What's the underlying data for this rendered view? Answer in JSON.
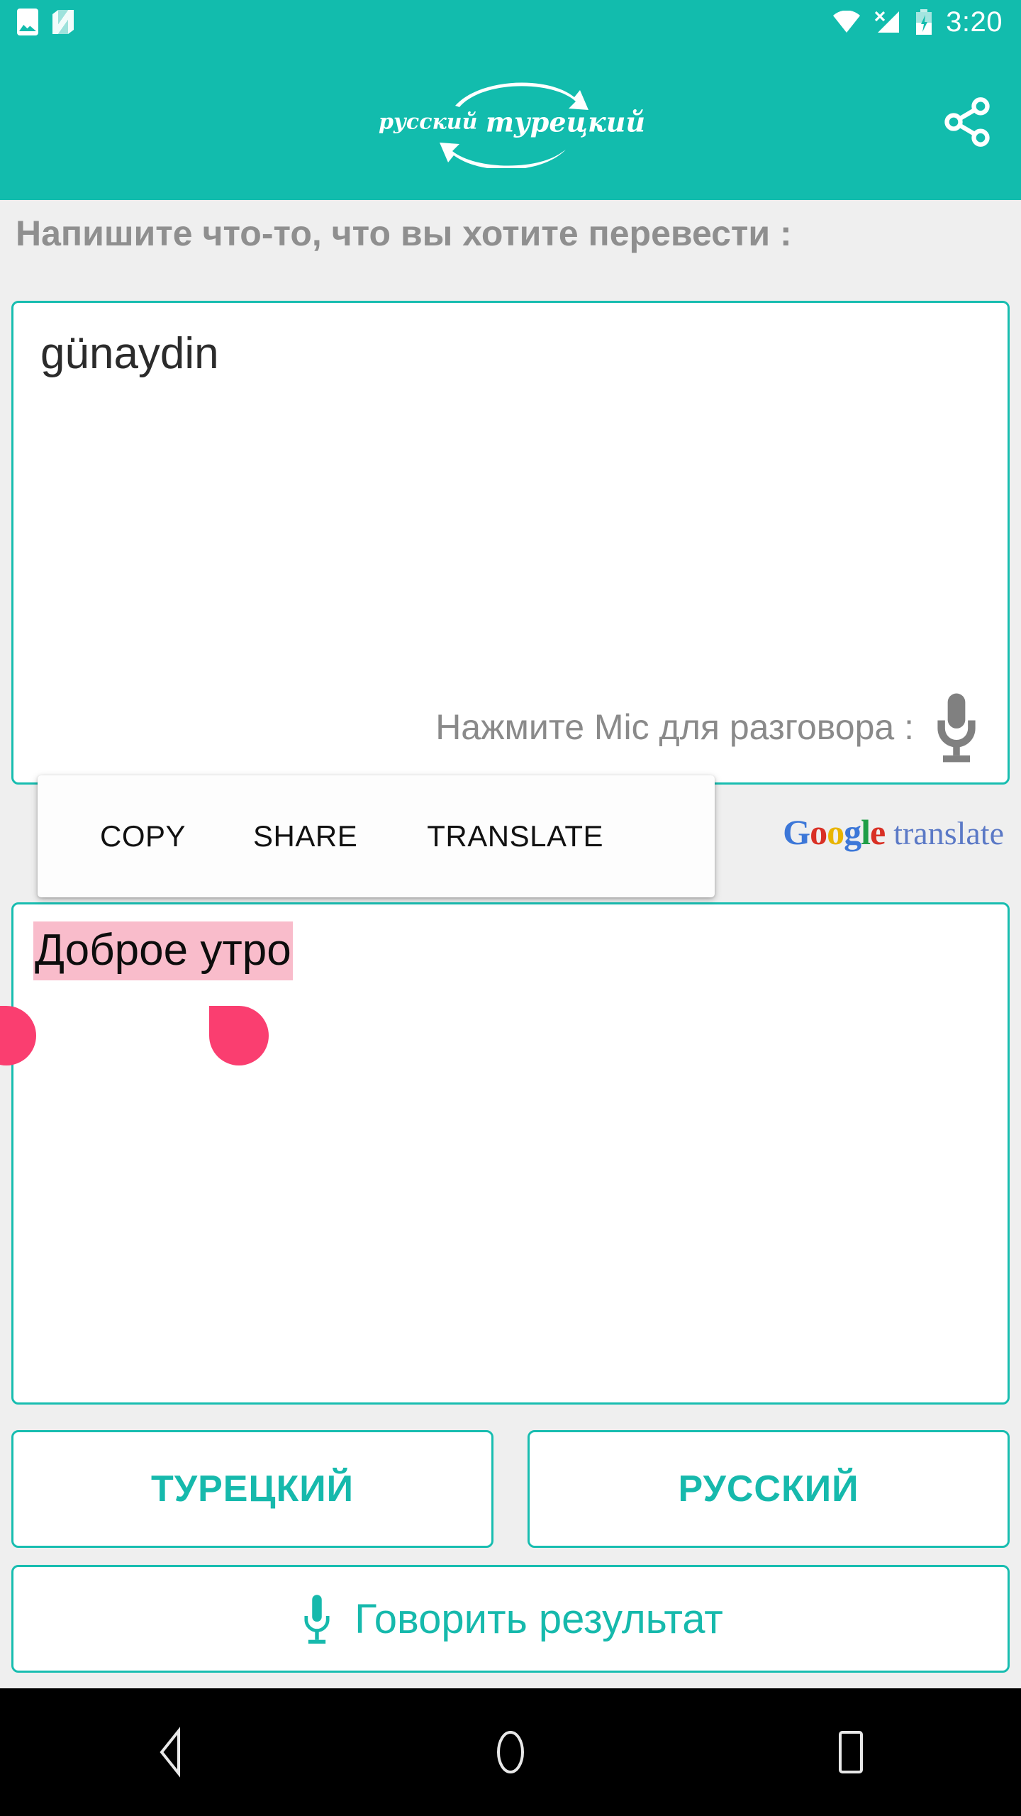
{
  "status_bar": {
    "time": "3:20",
    "icons": [
      "photos-icon",
      "nfc-icon",
      "wifi-icon",
      "signal-off-icon",
      "battery-charging-icon"
    ]
  },
  "app_bar": {
    "logo_source_label": "русский",
    "logo_target_label": "турецкий",
    "share_icon": "share-icon"
  },
  "main": {
    "prompt": "Напишите что-то, что вы хотите перевести :",
    "source_text": "günaydin",
    "mic_hint": "Нажмите Mic для разговора :",
    "mic_icon": "microphone-icon",
    "result_text": "Доброе утро",
    "google_translate": {
      "g": "G",
      "o1": "o",
      "o2": "o",
      "g2": "g",
      "l": "l",
      "e": "e",
      "translate": "translate"
    }
  },
  "context_menu": {
    "copy": "COPY",
    "share": "SHARE",
    "translate": "TRANSLATE"
  },
  "buttons": {
    "source_language": "ТУРЕЦКИЙ",
    "target_language": "РУССКИЙ",
    "speak_result": "Говорить результат",
    "speak_icon": "microphone-icon"
  },
  "nav_bar": {
    "back": "back-icon",
    "home": "home-icon",
    "recents": "recents-icon"
  },
  "colors": {
    "accent_teal": "#12BCAD",
    "border_teal": "#18BDB0",
    "page_bg": "#EFEFEF",
    "selection_highlight": "#F9BCCB",
    "selection_handle": "#FA3E70",
    "prompt_gray": "#8F8F8F"
  }
}
